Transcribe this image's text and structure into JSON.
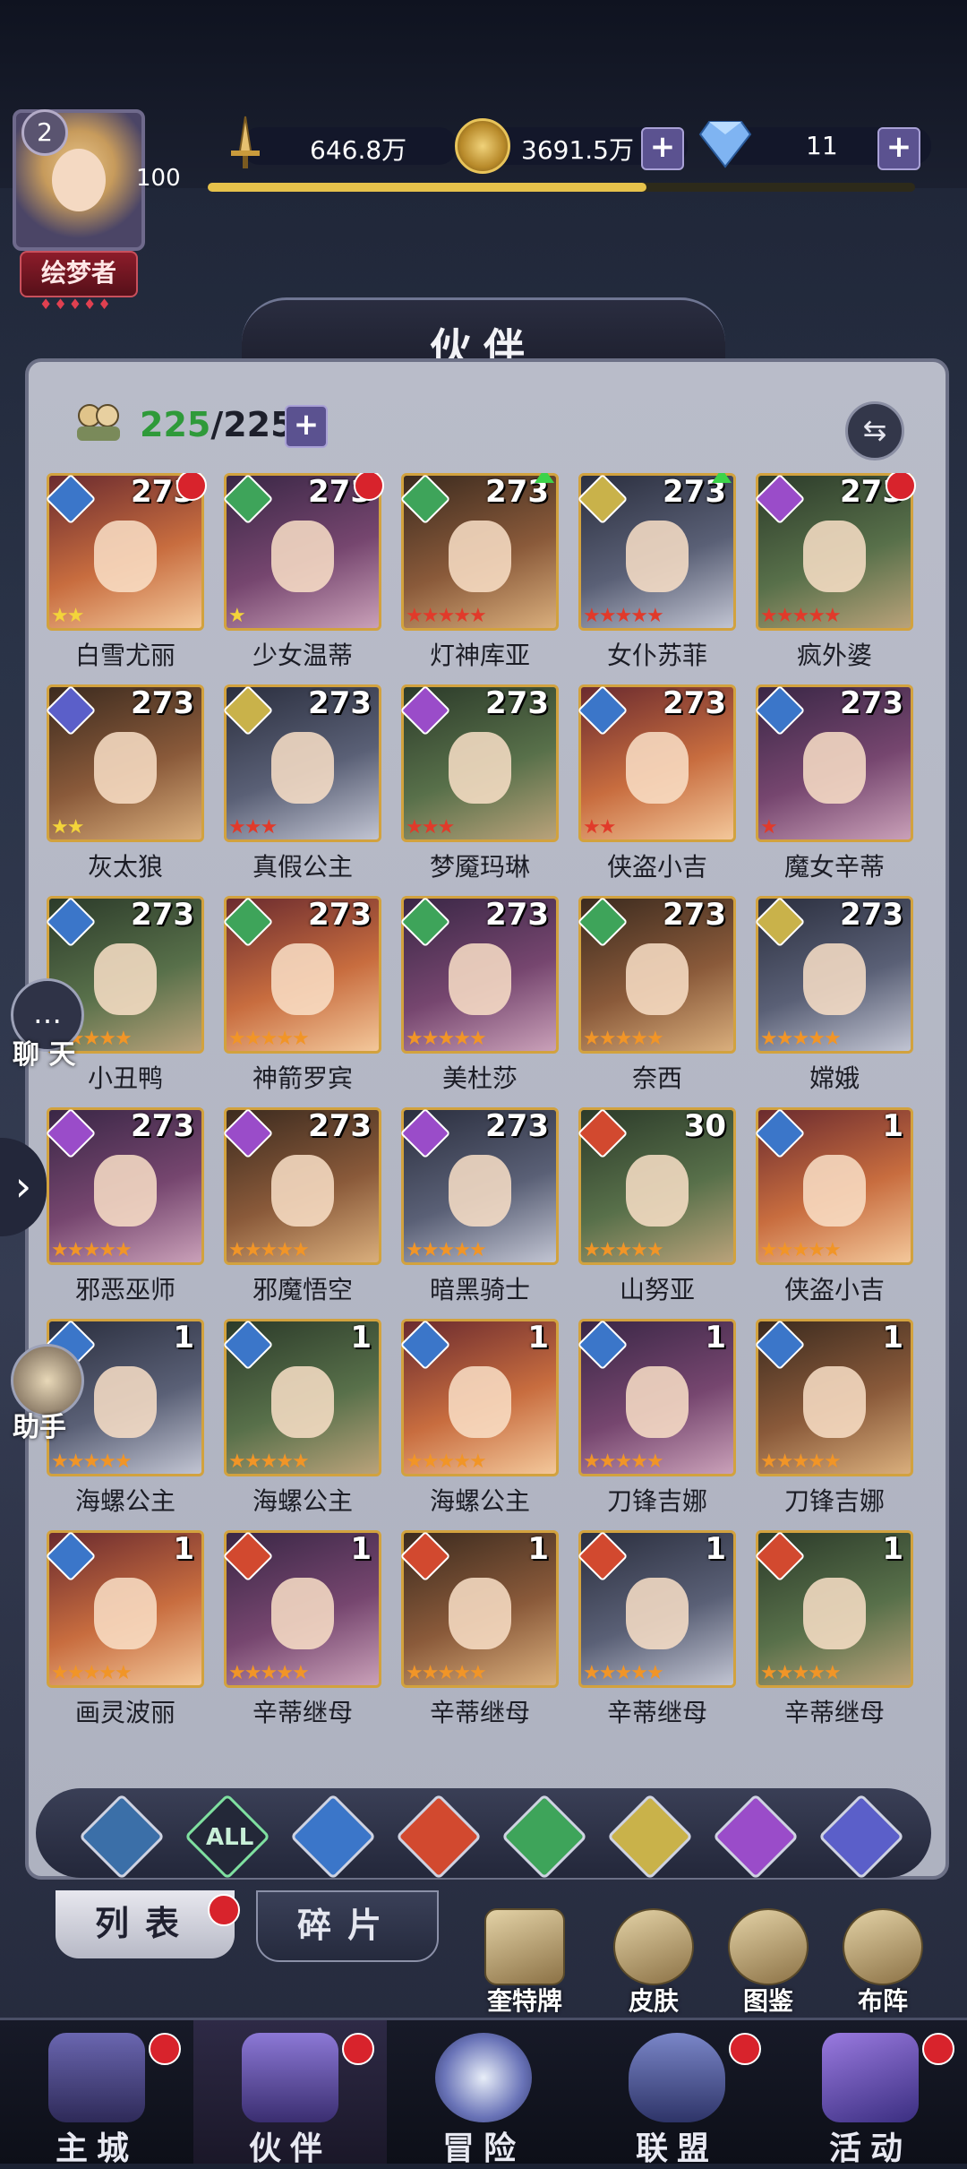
{
  "player": {
    "level": "2",
    "xp_level": "100",
    "title": "绘梦者",
    "title_dots": "♦♦♦♦♦",
    "xp_progress": 0.62
  },
  "resources": {
    "power": "646.8万",
    "gold": "3691.5万",
    "gems": "11"
  },
  "page_title": "伙伴",
  "roster": {
    "current": "225",
    "max": "/225"
  },
  "heroes": [
    {
      "name": "白雪尤丽",
      "level": "273",
      "element": "water",
      "stars": 2,
      "star_color": "gold",
      "flag": "red"
    },
    {
      "name": "少女温蒂",
      "level": "273",
      "element": "wind",
      "stars": 1,
      "star_color": "gold",
      "flag": "red"
    },
    {
      "name": "灯神库亚",
      "level": "273",
      "element": "wind",
      "stars": 5,
      "star_color": "red",
      "flag": "green"
    },
    {
      "name": "女仆苏菲",
      "level": "273",
      "element": "light",
      "stars": 5,
      "star_color": "red",
      "flag": "green"
    },
    {
      "name": "疯外婆",
      "level": "273",
      "element": "dark",
      "stars": 5,
      "star_color": "red",
      "flag": "red"
    },
    {
      "name": "灰太狼",
      "level": "273",
      "element": "space",
      "stars": 2,
      "star_color": "gold",
      "flag": ""
    },
    {
      "name": "真假公主",
      "level": "273",
      "element": "light",
      "stars": 3,
      "star_color": "red",
      "flag": ""
    },
    {
      "name": "梦魇玛琳",
      "level": "273",
      "element": "dark",
      "stars": 3,
      "star_color": "red",
      "flag": ""
    },
    {
      "name": "侠盗小吉",
      "level": "273",
      "element": "water",
      "stars": 2,
      "star_color": "red",
      "flag": ""
    },
    {
      "name": "魔女辛蒂",
      "level": "273",
      "element": "water",
      "stars": 1,
      "star_color": "red",
      "flag": ""
    },
    {
      "name": "小丑鸭",
      "level": "273",
      "element": "water",
      "stars": 5,
      "star_color": "orange",
      "flag": ""
    },
    {
      "name": "神箭罗宾",
      "level": "273",
      "element": "wind",
      "stars": 5,
      "star_color": "orange",
      "flag": ""
    },
    {
      "name": "美杜莎",
      "level": "273",
      "element": "wind",
      "stars": 5,
      "star_color": "orange",
      "flag": ""
    },
    {
      "name": "奈西",
      "level": "273",
      "element": "wind",
      "stars": 5,
      "star_color": "orange",
      "flag": ""
    },
    {
      "name": "嫦娥",
      "level": "273",
      "element": "light",
      "stars": 5,
      "star_color": "orange",
      "flag": ""
    },
    {
      "name": "邪恶巫师",
      "level": "273",
      "element": "dark",
      "stars": 5,
      "star_color": "orange",
      "flag": ""
    },
    {
      "name": "邪魔悟空",
      "level": "273",
      "element": "dark",
      "stars": 5,
      "star_color": "orange",
      "flag": ""
    },
    {
      "name": "暗黑骑士",
      "level": "273",
      "element": "dark",
      "stars": 5,
      "star_color": "orange",
      "flag": ""
    },
    {
      "name": "山努亚",
      "level": "30",
      "element": "fire",
      "stars": 5,
      "star_color": "orange",
      "flag": ""
    },
    {
      "name": "侠盗小吉",
      "level": "1",
      "element": "water",
      "stars": 5,
      "star_color": "orange",
      "flag": ""
    },
    {
      "name": "海螺公主",
      "level": "1",
      "element": "water",
      "stars": 5,
      "star_color": "orange",
      "flag": ""
    },
    {
      "name": "海螺公主",
      "level": "1",
      "element": "water",
      "stars": 5,
      "star_color": "orange",
      "flag": ""
    },
    {
      "name": "海螺公主",
      "level": "1",
      "element": "water",
      "stars": 5,
      "star_color": "orange",
      "flag": ""
    },
    {
      "name": "刀锋吉娜",
      "level": "1",
      "element": "water",
      "stars": 5,
      "star_color": "orange",
      "flag": ""
    },
    {
      "name": "刀锋吉娜",
      "level": "1",
      "element": "water",
      "stars": 5,
      "star_color": "orange",
      "flag": ""
    },
    {
      "name": "画灵波丽",
      "level": "1",
      "element": "water",
      "stars": 5,
      "star_color": "orange",
      "flag": ""
    },
    {
      "name": "辛蒂继母",
      "level": "1",
      "element": "fire",
      "stars": 5,
      "star_color": "orange",
      "flag": ""
    },
    {
      "name": "辛蒂继母",
      "level": "1",
      "element": "fire",
      "stars": 5,
      "star_color": "orange",
      "flag": ""
    },
    {
      "name": "辛蒂继母",
      "level": "1",
      "element": "fire",
      "stars": 5,
      "star_color": "orange",
      "flag": ""
    },
    {
      "name": "辛蒂继母",
      "level": "1",
      "element": "fire",
      "stars": 5,
      "star_color": "orange",
      "flag": ""
    }
  ],
  "side": {
    "chat_label": "聊 天",
    "helper_label": "助手"
  },
  "filters": {
    "all_label": "ALL"
  },
  "tabs": {
    "list": "列表",
    "fragments": "碎片"
  },
  "tools": {
    "cards": "奎特牌",
    "skins": "皮肤",
    "codex": "图鉴",
    "formation": "布阵"
  },
  "nav": {
    "main_city": "主城",
    "partners": "伙伴",
    "adventure": "冒险",
    "alliance": "联盟",
    "events": "活动"
  },
  "element_colors": {
    "water": "#3b76c9",
    "wind": "#3ea45a",
    "light": "#c9b24a",
    "dark": "#9a4cc9",
    "fire": "#d2492f",
    "space": "#5b5fc9"
  }
}
